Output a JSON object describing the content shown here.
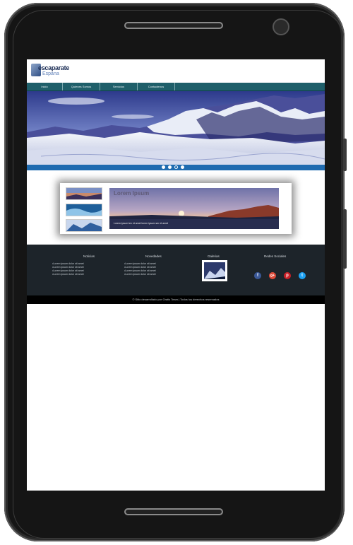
{
  "site": {
    "logo_line1": "escaparate",
    "logo_line2": "Espana"
  },
  "nav": {
    "items": [
      "Inicio",
      "Quienes Somos",
      "Servicios",
      "Contactenos"
    ]
  },
  "slider": {
    "dot_count": 4,
    "active_index": 2
  },
  "feature": {
    "title": "Lorem Ipsum",
    "caption": "Lorem ipsum tex et amet lorem ipsum ser et amet"
  },
  "footer": {
    "col1": {
      "title": "Noticias",
      "items": [
        "Lorem ipsum dolor sit amet",
        "Lorem ipsum dolor sit amet",
        "Lorem ipsum dolor sit amet",
        "Lorem ipsum dolor sit amet"
      ]
    },
    "col2": {
      "title": "Novedades",
      "items": [
        "Lorem ipsum dolor sit amet",
        "Lorem ipsum dolor sit amet",
        "Lorem ipsum dolor sit amet",
        "Lorem ipsum dolor sit amet"
      ]
    },
    "col3": {
      "title": "Galerias"
    },
    "col4": {
      "title": "Redes Sociales",
      "networks": [
        {
          "icon": "facebook-icon",
          "glyph": "f",
          "color": "#3b5998"
        },
        {
          "icon": "google-plus-icon",
          "glyph": "g+",
          "color": "#dd4b39"
        },
        {
          "icon": "pinterest-icon",
          "glyph": "p",
          "color": "#cb2027"
        },
        {
          "icon": "twitter-icon",
          "glyph": "t",
          "color": "#1da1f2"
        }
      ]
    },
    "copyright": "© Sitio desarrollado por Gratis Team | Todos los derechos reservados"
  },
  "colors": {
    "nav_bg": "#1f5f6a",
    "accent_blue": "#1f6bb0",
    "footer_bg": "#1d242a"
  }
}
